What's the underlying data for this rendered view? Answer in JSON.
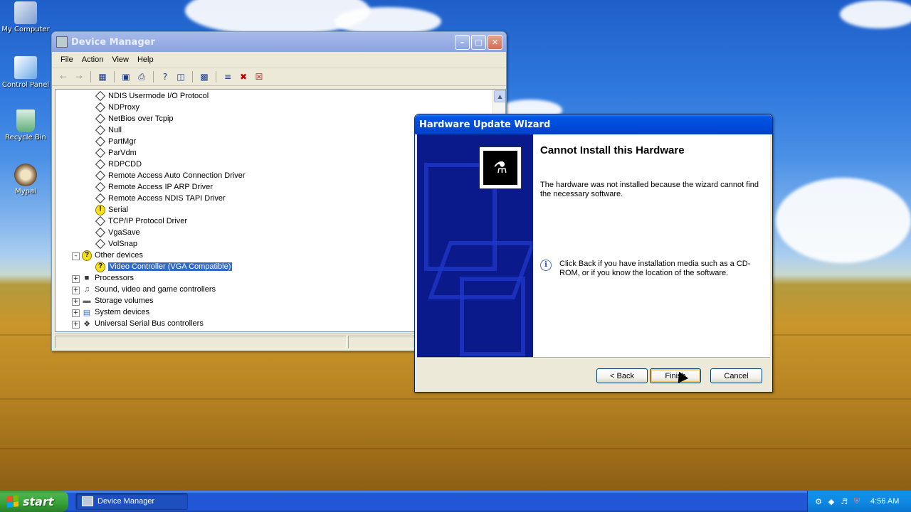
{
  "desktop": {
    "icons": [
      {
        "label": "My Computer",
        "icon": "my-computer-icon"
      },
      {
        "label": "Control Panel",
        "icon": "control-panel-icon"
      },
      {
        "label": "Recycle Bin",
        "icon": "recycle-bin-icon"
      },
      {
        "label": "Mypal",
        "icon": "mypal-browser-icon"
      }
    ]
  },
  "device_manager": {
    "title": "Device Manager",
    "menu": [
      "File",
      "Action",
      "View",
      "Help"
    ],
    "tree": {
      "items": [
        "NDIS Usermode I/O Protocol",
        "NDProxy",
        "NetBios over Tcpip",
        "Null",
        "PartMgr",
        "ParVdm",
        "RDPCDD",
        "Remote Access Auto Connection Driver",
        "Remote Access IP ARP Driver",
        "Remote Access NDIS TAPI Driver",
        "Serial",
        "TCP/IP Protocol Driver",
        "VgaSave",
        "VolSnap"
      ],
      "other_devices": "Other devices",
      "video_controller": "Video Controller (VGA Compatible)",
      "categories": [
        "Processors",
        "Sound, video and game controllers",
        "Storage volumes",
        "System devices",
        "Universal Serial Bus controllers"
      ]
    }
  },
  "wizard": {
    "title": "Hardware Update Wizard",
    "heading": "Cannot Install this Hardware",
    "message": "The hardware was not installed because the wizard cannot find the necessary software.",
    "info": "Click Back if you have installation media such as a CD-ROM, or if you know the location of the software.",
    "buttons": {
      "back": "< Back",
      "finish": "Finish",
      "cancel": "Cancel"
    }
  },
  "taskbar": {
    "start_label": "start",
    "task": "Device Manager",
    "clock": "4:56 AM"
  },
  "colors": {
    "xp_blue": "#0055e5",
    "start_green": "#36a136",
    "selection": "#316ac5"
  }
}
